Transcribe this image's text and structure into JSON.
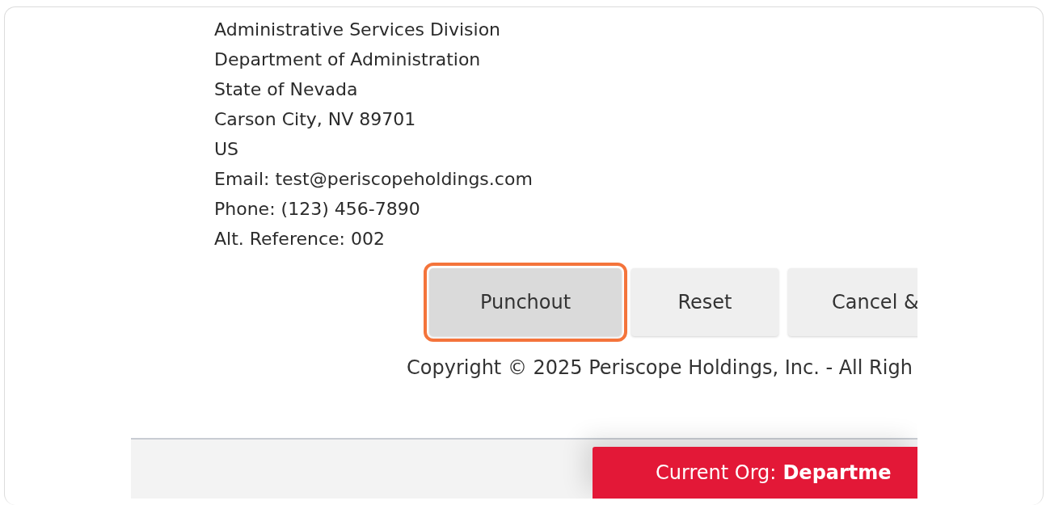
{
  "address": [
    "Administrative Services Division",
    "Department of Administration",
    "State of Nevada",
    "Carson City, NV 89701",
    "US",
    "Email: test@periscopeholdings.com",
    "Phone: (123) 456-7890",
    "Alt. Reference: 002"
  ],
  "buttons": [
    {
      "label": "Punchout",
      "highlighted": true
    },
    {
      "label": "Reset",
      "highlighted": false
    },
    {
      "label": "Cancel &",
      "highlighted": false
    }
  ],
  "copyright": "Copyright © 2025 Periscope Holdings, Inc. - All Righ",
  "footer": {
    "org_label": "Current Org:",
    "org_value": "Departme"
  }
}
